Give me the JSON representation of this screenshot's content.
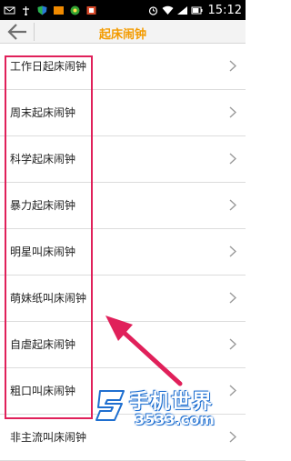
{
  "status_bar": {
    "time": "15:12",
    "battery_percent": 80
  },
  "header": {
    "title": "起床闹钟"
  },
  "alarm_list": {
    "items": [
      {
        "label": "工作日起床闹钟"
      },
      {
        "label": "周末起床闹钟"
      },
      {
        "label": "科学起床闹钟"
      },
      {
        "label": "暴力起床闹钟"
      },
      {
        "label": "明星叫床闹钟"
      },
      {
        "label": "萌妹纸叫床闹钟"
      },
      {
        "label": "自虐起床闹钟"
      },
      {
        "label": "粗口叫床闹钟"
      },
      {
        "label": "非主流叫床闹钟"
      }
    ]
  },
  "watermark": {
    "main": "手机世界",
    "sub": "3533.com"
  },
  "colors": {
    "title": "#f39b00",
    "annotation": "#e0205a",
    "watermark_blue": "#1f6fd0"
  }
}
